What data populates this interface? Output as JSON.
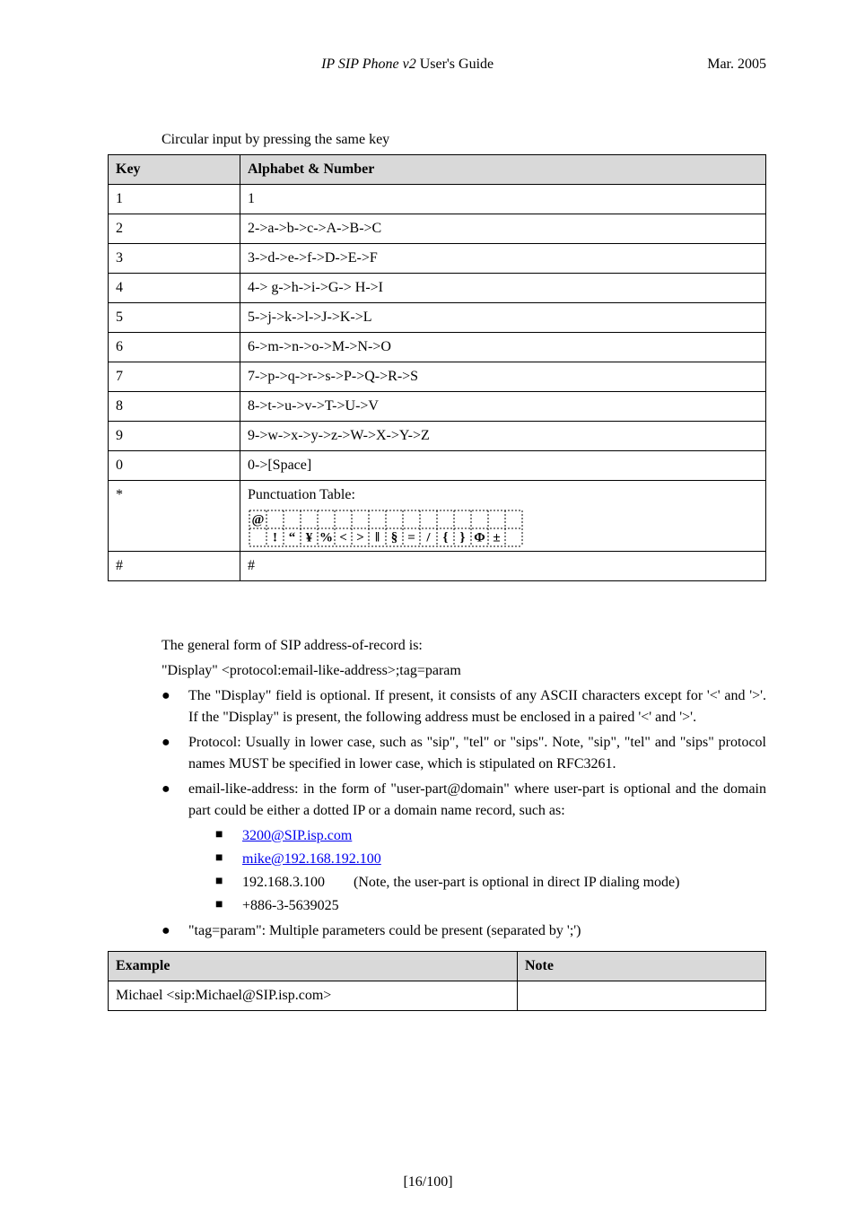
{
  "header": {
    "title_italic": "IP SIP Phone v2",
    "title_plain": " User's Guide",
    "date": "Mar. 2005"
  },
  "table_caption": "Circular input by pressing the same key",
  "key_table": {
    "headers": {
      "key": "Key",
      "alphabet": "Alphabet & Number"
    },
    "rows": [
      {
        "key": "1",
        "val": "1"
      },
      {
        "key": "2",
        "val": "2->a->b->c->A->B->C"
      },
      {
        "key": "3",
        "val": "3->d->e->f->D->E->F"
      },
      {
        "key": "4",
        "val": "4-> g->h->i->G-> H->I"
      },
      {
        "key": "5",
        "val": "5->j->k->l->J->K->L"
      },
      {
        "key": "6",
        "val": "6->m->n->o->M->N->O"
      },
      {
        "key": "7",
        "val": "7->p->q->r->s->P->Q->R->S"
      },
      {
        "key": "8",
        "val": "8->t->u->v->T->U->V"
      },
      {
        "key": "9",
        "val": "9->w->x->y->z->W->X->Y->Z"
      },
      {
        "key": "0",
        "val": "0->[Space]"
      },
      {
        "key": "*",
        "val": "Punctuation Table:"
      },
      {
        "key": "#",
        "val": "#"
      }
    ]
  },
  "punctuation": {
    "cells_row0": [
      "@",
      "",
      "",
      "",
      "",
      "",
      "",
      "",
      "",
      "",
      "",
      "",
      "",
      "",
      "",
      ""
    ],
    "cells_row1": [
      "",
      "!",
      "“",
      "¥",
      "%",
      "<",
      ">",
      "‖",
      "§",
      "=",
      "/",
      "{",
      "}",
      "Φ",
      "±",
      ""
    ]
  },
  "intro": {
    "line1": "The general form of SIP address-of-record is:",
    "line2": "\"Display\" <protocol:email-like-address>;tag=param"
  },
  "bullets": [
    "The \"Display\" field is optional. If present, it consists of any ASCII characters except for '<' and '>'. If the \"Display\" is present, the following address must be enclosed in a paired '<' and '>'.",
    "Protocol: Usually in lower case, such as \"sip\", \"tel\" or \"sips\". Note, \"sip\", \"tel\" and \"sips\" protocol names MUST be specified in lower case, which is stipulated on RFC3261.",
    "email-like-address: in the form of \"user-part@domain\" where user-part is optional and the domain part could be either a dotted IP or a domain name record, such as:"
  ],
  "squares": {
    "link1": "3200@SIP.isp.com",
    "link2": "mike@192.168.192.100",
    "ip": "192.168.3.100",
    "ip_note": "(Note, the user-part is optional in direct IP dialing mode)",
    "phone": "+886-3-5639025"
  },
  "bullet_tag": "\"tag=param\": Multiple parameters could be present (separated by ';')",
  "example_table": {
    "headers": {
      "example": "Example",
      "note": "Note"
    },
    "rows": [
      {
        "example": "Michael <sip:Michael@SIP.isp.com>",
        "note": ""
      }
    ]
  },
  "footer": "[16/100]"
}
